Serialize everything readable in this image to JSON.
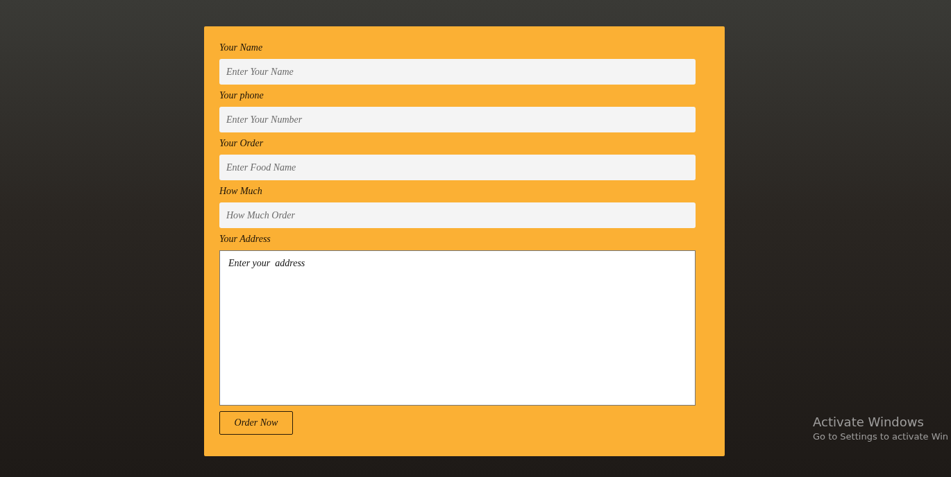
{
  "form": {
    "fields": [
      {
        "kind": "input",
        "label": "Your Name",
        "placeholder": "Enter Your Name"
      },
      {
        "kind": "input",
        "label": "Your phone",
        "placeholder": "Enter Your Number"
      },
      {
        "kind": "input",
        "label": "Your Order",
        "placeholder": "Enter Food Name"
      },
      {
        "kind": "input",
        "label": "How Much",
        "placeholder": "How Much Order"
      },
      {
        "kind": "textarea",
        "label": "Your Address",
        "value": "Enter your  address"
      }
    ],
    "submit": "Order Now"
  },
  "os_notice": {
    "title": "Activate Windows",
    "text": "Go to Settings to activate Win"
  }
}
